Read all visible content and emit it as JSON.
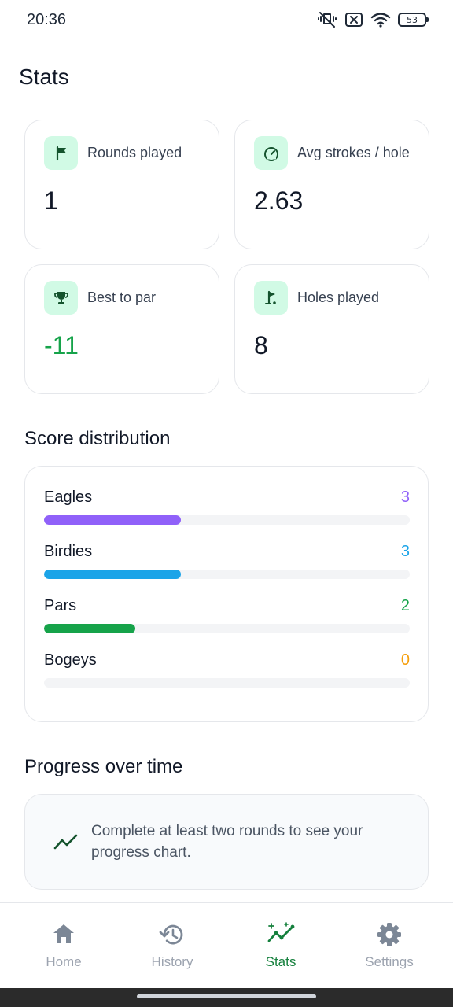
{
  "status_bar": {
    "time": "20:36",
    "battery": "53",
    "icons": [
      "mute-vibrate-icon",
      "sim-blocked-icon",
      "wifi-icon",
      "battery-icon"
    ]
  },
  "page": {
    "title": "Stats"
  },
  "stats": [
    {
      "label": "Rounds played",
      "value": "1",
      "icon": "flag-icon"
    },
    {
      "label": "Avg strokes / hole",
      "value": "2.63",
      "icon": "speedometer-icon"
    },
    {
      "label": "Best to par",
      "value": "-11",
      "icon": "trophy-icon"
    },
    {
      "label": "Holes played",
      "value": "8",
      "icon": "golf-hole-icon"
    }
  ],
  "score_distribution": {
    "title": "Score distribution",
    "rows": [
      {
        "label": "Eagles",
        "count": "3",
        "fraction": 0.375,
        "color": "#9061f9"
      },
      {
        "label": "Birdies",
        "count": "3",
        "fraction": 0.375,
        "color": "#1ba4e8"
      },
      {
        "label": "Pars",
        "count": "2",
        "fraction": 0.25,
        "color": "#16a34a"
      },
      {
        "label": "Bogeys",
        "count": "0",
        "fraction": 0,
        "color": "#f59e0b"
      }
    ]
  },
  "progress": {
    "title": "Progress over time",
    "empty_message": "Complete at least two rounds to see your progress chart.",
    "icon": "trend-line-icon"
  },
  "nav": {
    "items": [
      {
        "label": "Home",
        "icon": "home-icon",
        "active": false
      },
      {
        "label": "History",
        "icon": "history-icon",
        "active": false
      },
      {
        "label": "Stats",
        "icon": "stats-sparkle-icon",
        "active": true
      },
      {
        "label": "Settings",
        "icon": "gear-icon",
        "active": false
      }
    ]
  },
  "colors": {
    "accent": "#15803d",
    "icon_bg": "#d1fae5",
    "positive": "#16a34a"
  }
}
